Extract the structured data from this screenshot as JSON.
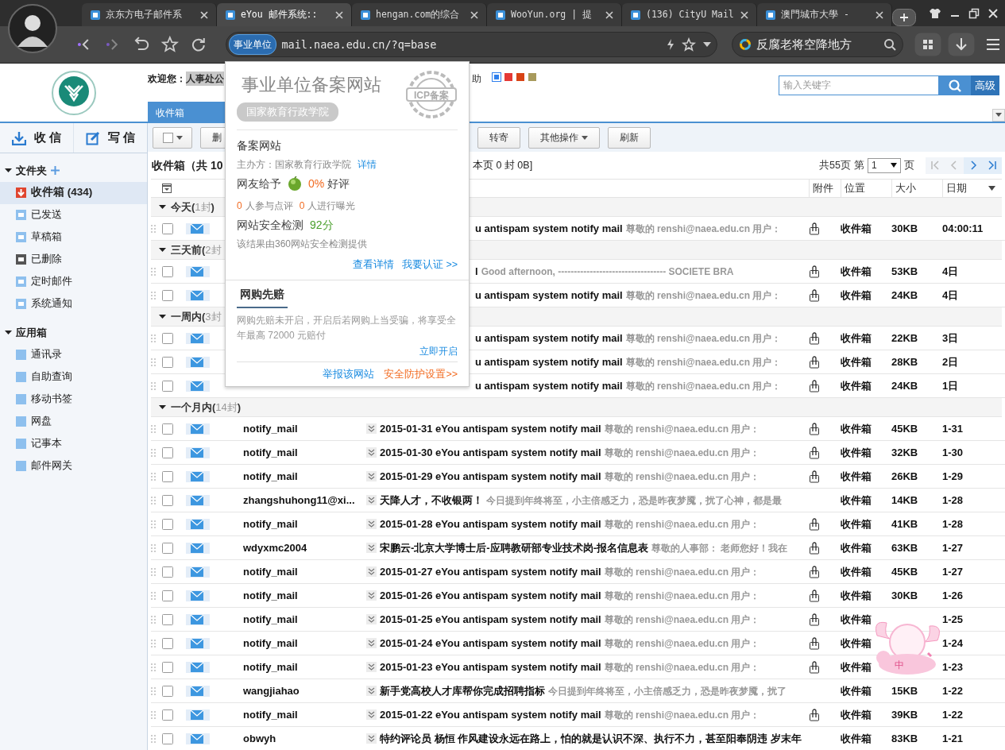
{
  "browser": {
    "tabs": [
      {
        "title": "京东方电子邮件系",
        "selected": false
      },
      {
        "title": "eYou 邮件系统::",
        "selected": true
      },
      {
        "title": "hengan.com的综合",
        "selected": false
      },
      {
        "title": "WooYun.org | 提",
        "selected": false
      },
      {
        "title": "(136) CityU Mail",
        "selected": false
      },
      {
        "title": "澳門城市大學 -",
        "selected": false
      }
    ],
    "address": {
      "badge": "事业单位",
      "url": "mail.naea.edu.cn/?q=base"
    },
    "search": {
      "value": "反腐老将空降地方"
    }
  },
  "header": {
    "welcome_label": "欢迎您：",
    "user": "人事处公",
    "help": "助",
    "skins": [
      {
        "color": "#2f80ed",
        "selected": true
      },
      {
        "color": "#e53935",
        "selected": false
      },
      {
        "color": "#d84315",
        "selected": false
      },
      {
        "color": "#a89a5c",
        "selected": false
      }
    ],
    "search": {
      "placeholder": "输入关键字",
      "advanced": "高级"
    },
    "tab": "收件箱"
  },
  "sidebar": {
    "actions": [
      {
        "kind": "receive",
        "label": "收 信"
      },
      {
        "kind": "compose",
        "label": "写 信"
      }
    ],
    "sections": [
      {
        "title": "文件夹",
        "expanded": true,
        "addable": true,
        "items": [
          {
            "label": "收件箱 (434)",
            "kind": "inbox",
            "selected": true
          },
          {
            "label": "已发送",
            "kind": "folder",
            "selected": false
          },
          {
            "label": "草稿箱",
            "kind": "folder",
            "selected": false
          },
          {
            "label": "已删除",
            "kind": "trash",
            "selected": false
          },
          {
            "label": "定时邮件",
            "kind": "folder",
            "selected": false
          },
          {
            "label": "系统通知",
            "kind": "folder",
            "selected": false
          }
        ]
      },
      {
        "title": "应用箱",
        "expanded": true,
        "addable": false,
        "items": [
          {
            "label": "通讯录",
            "kind": "app",
            "selected": false
          },
          {
            "label": "自助查询",
            "kind": "app",
            "selected": false
          },
          {
            "label": "移动书签",
            "kind": "app",
            "selected": false
          },
          {
            "label": "网盘",
            "kind": "app",
            "selected": false
          },
          {
            "label": "记事本",
            "kind": "app",
            "selected": false
          },
          {
            "label": "邮件网关",
            "kind": "app",
            "selected": false
          }
        ]
      }
    ]
  },
  "toolbar": {
    "buttons": [
      {
        "kind": "select"
      },
      {
        "kind": "cut",
        "label": "删"
      },
      {
        "kind": "button",
        "label": "转寄"
      },
      {
        "kind": "dropdown",
        "label": "其他操作"
      },
      {
        "kind": "button",
        "label": "刷新"
      }
    ]
  },
  "summary": {
    "left": "收件箱（共 10",
    "right": "本页 0 封 0B]"
  },
  "pagination": {
    "total": "共55页",
    "page_label": "第",
    "page": "1",
    "unit": "页",
    "nav": [
      {
        "kind": "first",
        "disabled": true
      },
      {
        "kind": "prev",
        "disabled": true
      },
      {
        "kind": "next",
        "disabled": false
      },
      {
        "kind": "last",
        "disabled": false
      }
    ]
  },
  "columns": [
    "附件",
    "位置",
    "大小",
    "日期"
  ],
  "groups": [
    {
      "title": "今天(",
      "count": "1封",
      "close": ")",
      "expanded": true,
      "rows": [
        {
          "checked": false,
          "covered": true,
          "subject": "u antispam system notify mail",
          "preview": "尊敬的 renshi@naea.edu.cn 用户：",
          "attachment": true,
          "location": "收件箱",
          "size": "30KB",
          "date": "04:00:11"
        }
      ]
    },
    {
      "title": "三天前(",
      "count": "2封",
      "expanded": true,
      "rows": [
        {
          "checked": false,
          "covered": true,
          "subject": "l",
          "preview": "Good afternoon, ---------------------------------- SOCIETE BRA",
          "attachment": true,
          "location": "收件箱",
          "size": "53KB",
          "date": "4日"
        },
        {
          "checked": false,
          "covered": true,
          "subject": "u antispam system notify mail",
          "preview": "尊敬的 renshi@naea.edu.cn 用户：",
          "attachment": true,
          "location": "收件箱",
          "size": "24KB",
          "date": "4日"
        }
      ]
    },
    {
      "title": "一周内(",
      "count": "3封",
      "expanded": true,
      "rows": [
        {
          "checked": false,
          "covered": true,
          "subject": "u antispam system notify mail",
          "preview": "尊敬的 renshi@naea.edu.cn 用户：",
          "attachment": true,
          "location": "收件箱",
          "size": "22KB",
          "date": "3日"
        },
        {
          "checked": false,
          "covered": true,
          "subject": "u antispam system notify mail",
          "preview": "尊敬的 renshi@naea.edu.cn 用户：",
          "attachment": true,
          "location": "收件箱",
          "size": "28KB",
          "date": "2日"
        },
        {
          "checked": false,
          "covered": true,
          "subject": "u antispam system notify mail",
          "preview": "尊敬的 renshi@naea.edu.cn 用户：",
          "attachment": true,
          "location": "收件箱",
          "size": "24KB",
          "date": "1日"
        }
      ]
    },
    {
      "title": "一个月内(",
      "count": "14封",
      "close": ")",
      "expanded": true,
      "rows": [
        {
          "checked": false,
          "covered": false,
          "sender": "notify_mail",
          "subject": "2015-01-31 eYou antispam system notify mail",
          "preview": "尊敬的 renshi@naea.edu.cn 用户：",
          "attachment": true,
          "location": "收件箱",
          "size": "45KB",
          "date": "1-31"
        },
        {
          "checked": false,
          "covered": false,
          "sender": "notify_mail",
          "subject": "2015-01-30 eYou antispam system notify mail",
          "preview": "尊敬的 renshi@naea.edu.cn 用户：",
          "attachment": true,
          "location": "收件箱",
          "size": "32KB",
          "date": "1-30"
        },
        {
          "checked": false,
          "covered": false,
          "sender": "notify_mail",
          "subject": "2015-01-29 eYou antispam system notify mail",
          "preview": "尊敬的 renshi@naea.edu.cn 用户：",
          "attachment": true,
          "location": "收件箱",
          "size": "26KB",
          "date": "1-29"
        },
        {
          "checked": false,
          "covered": false,
          "sender": "zhangshuhong11@xi...",
          "subject": "天降人才，不收银两！",
          "preview": "今日提到年终将至，小主倍感乏力，恐是昨夜梦魇，扰了心神，都是最",
          "attachment": false,
          "location": "收件箱",
          "size": "14KB",
          "date": "1-28"
        },
        {
          "checked": false,
          "covered": false,
          "sender": "notify_mail",
          "subject": "2015-01-28 eYou antispam system notify mail",
          "preview": "尊敬的 renshi@naea.edu.cn 用户：",
          "attachment": true,
          "location": "收件箱",
          "size": "41KB",
          "date": "1-28"
        },
        {
          "checked": false,
          "covered": false,
          "sender": "wdyxmc2004",
          "subject": "宋鹏云-北京大学博士后-应聘教研部专业技术岗-报名信息表",
          "preview": "尊敬的人事部： 老师您好！我在",
          "attachment": true,
          "location": "收件箱",
          "size": "63KB",
          "date": "1-27"
        },
        {
          "checked": false,
          "covered": false,
          "sender": "notify_mail",
          "subject": "2015-01-27 eYou antispam system notify mail",
          "preview": "尊敬的 renshi@naea.edu.cn 用户：",
          "attachment": true,
          "location": "收件箱",
          "size": "45KB",
          "date": "1-27"
        },
        {
          "checked": false,
          "covered": false,
          "sender": "notify_mail",
          "subject": "2015-01-26 eYou antispam system notify mail",
          "preview": "尊敬的 renshi@naea.edu.cn 用户：",
          "attachment": true,
          "location": "收件箱",
          "size": "30KB",
          "date": "1-26"
        },
        {
          "checked": false,
          "covered": false,
          "sender": "notify_mail",
          "subject": "2015-01-25 eYou antispam system notify mail",
          "preview": "尊敬的 renshi@naea.edu.cn 用户：",
          "attachment": true,
          "location": "收件箱",
          "date": "1-25"
        },
        {
          "checked": false,
          "covered": false,
          "sender": "notify_mail",
          "subject": "2015-01-24 eYou antispam system notify mail",
          "preview": "尊敬的 renshi@naea.edu.cn 用户：",
          "attachment": true,
          "location": "收件箱",
          "date": "1-24"
        },
        {
          "checked": false,
          "covered": false,
          "sender": "notify_mail",
          "subject": "2015-01-23 eYou antispam system notify mail",
          "preview": "尊敬的 renshi@naea.edu.cn 用户：",
          "attachment": true,
          "location": "收件箱",
          "date": "1-23"
        },
        {
          "checked": false,
          "covered": false,
          "sender": "wangjiahao",
          "subject": "新手党高校人才库帮你完成招聘指标",
          "preview": "今日提到年终将至，小主倍感乏力，恐是昨夜梦魇，扰了",
          "attachment": false,
          "location": "收件箱",
          "size": "15KB",
          "date": "1-22"
        },
        {
          "checked": false,
          "covered": false,
          "sender": "notify_mail",
          "subject": "2015-01-22 eYou antispam system notify mail",
          "preview": "尊敬的 renshi@naea.edu.cn 用户：",
          "attachment": true,
          "location": "收件箱",
          "size": "39KB",
          "date": "1-22"
        },
        {
          "checked": false,
          "covered": false,
          "sender": "obwyh",
          "subject": "特约评论员 杨恒 作风建设永远在路上，怕的就是认识不深、执行不力，甚至阳奉阴违 岁末年",
          "attachment": false,
          "location": "收件箱",
          "size": "83KB",
          "date": "1-21"
        }
      ]
    }
  ],
  "popup": {
    "title": "事业单位备案网站",
    "org_badge": "国家教育行政学院",
    "stamp": "ICP备案",
    "section": "备案网站",
    "sponsor": "主办方：国家教育行政学院",
    "sponsor_link": "详情",
    "rating": {
      "label": "网友给予",
      "value": "0%",
      "suffix": "好评"
    },
    "stats": [
      {
        "count": "0",
        "label": "人参与点评"
      },
      {
        "count": "0",
        "label": "人进行曝光"
      }
    ],
    "safety": {
      "label": "网站安全检测",
      "score": "92分"
    },
    "source": "该结果由360网站安全检测提供",
    "links": [
      "查看详情",
      "我要认证 >>"
    ],
    "guarantee": {
      "title": "网购先赔",
      "text": "网购先赔未开启，开启后若网购上当受骗，将享受全年最高 72000 元赔付",
      "action": "立即开启"
    },
    "footer_links": [
      {
        "label": "举报该网站",
        "kind": "report"
      },
      {
        "label": "安全防护设置>>",
        "kind": "settings"
      }
    ]
  },
  "ime": {
    "mode": "中"
  }
}
